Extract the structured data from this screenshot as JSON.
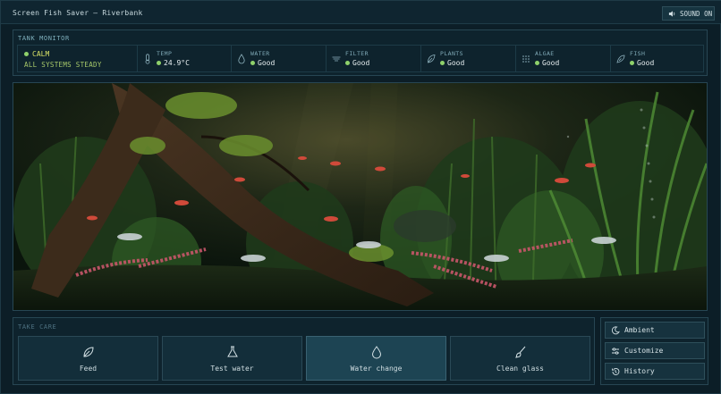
{
  "window": {
    "title": "Screen Fish Saver — Riverbank"
  },
  "sound": {
    "label": "SOUND ON",
    "icon": "speaker-icon"
  },
  "monitor": {
    "title": "TANK MONITOR",
    "status": {
      "state": "CALM",
      "summary": "ALL SYSTEMS STEADY",
      "color": "#d6e066"
    },
    "metrics": [
      {
        "label": "TEMP",
        "value": "24.9°C",
        "icon": "thermometer-icon"
      },
      {
        "label": "WATER",
        "value": "Good",
        "icon": "water-drop-icon"
      },
      {
        "label": "FILTER",
        "value": "Good",
        "icon": "filter-icon"
      },
      {
        "label": "PLANTS",
        "value": "Good",
        "icon": "leaf-icon"
      },
      {
        "label": "ALGAE",
        "value": "Good",
        "icon": "algae-dots-icon"
      },
      {
        "label": "FISH",
        "value": "Good",
        "icon": "fish-icon"
      }
    ],
    "good_color": "#8fd16b"
  },
  "care": {
    "title": "TAKE CARE",
    "actions": [
      {
        "label": "Feed",
        "icon": "feed-leaf-icon"
      },
      {
        "label": "Test water",
        "icon": "flask-icon"
      },
      {
        "label": "Water change",
        "icon": "water-drop-icon",
        "active": true
      },
      {
        "label": "Clean glass",
        "icon": "brush-icon"
      }
    ]
  },
  "side": {
    "buttons": [
      {
        "label": "Ambient",
        "icon": "moon-icon"
      },
      {
        "label": "Customize",
        "icon": "sliders-icon"
      },
      {
        "label": "History",
        "icon": "history-icon"
      }
    ]
  },
  "colors": {
    "accent": "#7fb0bd",
    "panel": "#0e232d",
    "active": "#1d4453"
  }
}
